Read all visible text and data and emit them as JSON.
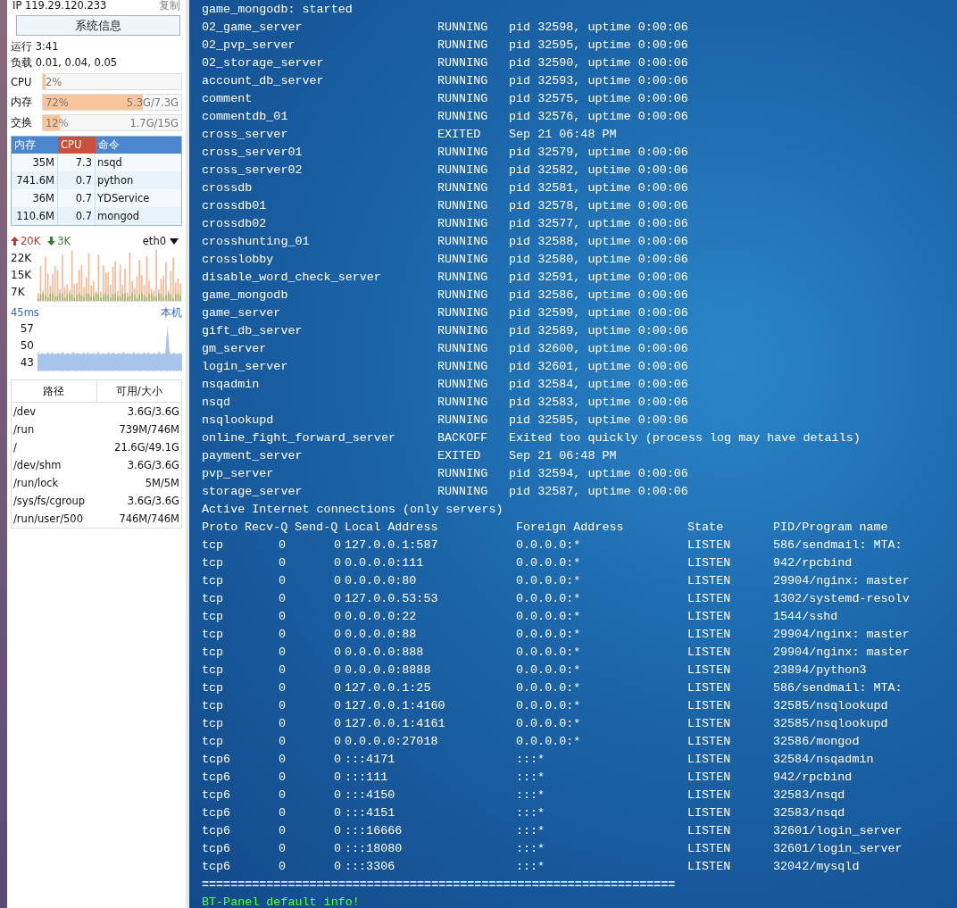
{
  "sidebar": {
    "ip": "IP 119.29.120.233",
    "copy_link": "复制",
    "sysinfo_button": "系统信息",
    "uptime": "运行 3:41",
    "load": "负载 0.01, 0.04, 0.05",
    "meters": [
      {
        "label": "CPU",
        "percent": "2%",
        "level": 0.02
      },
      {
        "label": "内存",
        "percent": "72%",
        "amount": "5.3G/7.3G",
        "level": 0.72
      },
      {
        "label": "交换",
        "percent": "12%",
        "amount": "1.7G/15G",
        "level": 0.12
      }
    ],
    "process_table": {
      "columns": [
        {
          "label": "内存",
          "selected": false
        },
        {
          "label": "CPU",
          "selected": true
        },
        {
          "label": "命令",
          "selected": false
        }
      ],
      "rows": [
        [
          "35M",
          "7.3",
          "nsqd"
        ],
        [
          "741.6M",
          "0.7",
          "python"
        ],
        [
          "36M",
          "0.7",
          "YDService"
        ],
        [
          "110.6M",
          "0.7",
          "mongod"
        ]
      ]
    },
    "network": {
      "up": "20K",
      "down": "3K",
      "interface": "eth0",
      "ticks": [
        "22K",
        "15K",
        "7K"
      ]
    },
    "ping": {
      "latency": "45ms",
      "host": "本机",
      "ticks": [
        "57",
        "50",
        "43"
      ]
    },
    "disk_table": {
      "columns": [
        "路径",
        "可用/大小"
      ],
      "rows": [
        [
          "/dev",
          "3.6G/3.6G"
        ],
        [
          "/run",
          "739M/746M"
        ],
        [
          "/",
          "21.6G/49.1G"
        ],
        [
          "/dev/shm",
          "3.6G/3.6G"
        ],
        [
          "/run/lock",
          "5M/5M"
        ],
        [
          "/sys/fs/cgroup",
          "3.6G/3.6G"
        ],
        [
          "/run/user/500",
          "746M/746M"
        ]
      ]
    }
  },
  "terminal": {
    "first_line": "game_mongodb: started",
    "services": [
      [
        "02_game_server",
        "RUNNING",
        "pid 32598, uptime 0:00:06"
      ],
      [
        "02_pvp_server",
        "RUNNING",
        "pid 32595, uptime 0:00:06"
      ],
      [
        "02_storage_server",
        "RUNNING",
        "pid 32590, uptime 0:00:06"
      ],
      [
        "account_db_server",
        "RUNNING",
        "pid 32593, uptime 0:00:06"
      ],
      [
        "comment",
        "RUNNING",
        "pid 32575, uptime 0:00:06"
      ],
      [
        "commentdb_01",
        "RUNNING",
        "pid 32576, uptime 0:00:06"
      ],
      [
        "cross_server",
        "EXITED",
        "Sep 21 06:48 PM"
      ],
      [
        "cross_server01",
        "RUNNING",
        "pid 32579, uptime 0:00:06"
      ],
      [
        "cross_server02",
        "RUNNING",
        "pid 32582, uptime 0:00:06"
      ],
      [
        "crossdb",
        "RUNNING",
        "pid 32581, uptime 0:00:06"
      ],
      [
        "crossdb01",
        "RUNNING",
        "pid 32578, uptime 0:00:06"
      ],
      [
        "crossdb02",
        "RUNNING",
        "pid 32577, uptime 0:00:06"
      ],
      [
        "crosshunting_01",
        "RUNNING",
        "pid 32588, uptime 0:00:06"
      ],
      [
        "crosslobby",
        "RUNNING",
        "pid 32580, uptime 0:00:06"
      ],
      [
        "disable_word_check_server",
        "RUNNING",
        "pid 32591, uptime 0:00:06"
      ],
      [
        "game_mongodb",
        "RUNNING",
        "pid 32586, uptime 0:00:06"
      ],
      [
        "game_server",
        "RUNNING",
        "pid 32599, uptime 0:00:06"
      ],
      [
        "gift_db_server",
        "RUNNING",
        "pid 32589, uptime 0:00:06"
      ],
      [
        "gm_server",
        "RUNNING",
        "pid 32600, uptime 0:00:06"
      ],
      [
        "login_server",
        "RUNNING",
        "pid 32601, uptime 0:00:06"
      ],
      [
        "nsqadmin",
        "RUNNING",
        "pid 32584, uptime 0:00:06"
      ],
      [
        "nsqd",
        "RUNNING",
        "pid 32583, uptime 0:00:06"
      ],
      [
        "nsqlookupd",
        "RUNNING",
        "pid 32585, uptime 0:00:06"
      ],
      [
        "online_fight_forward_server",
        "BACKOFF",
        "Exited too quickly (process log may have details)"
      ],
      [
        "payment_server",
        "EXITED",
        "Sep 21 06:48 PM"
      ],
      [
        "pvp_server",
        "RUNNING",
        "pid 32594, uptime 0:00:06"
      ],
      [
        "storage_server",
        "RUNNING",
        "pid 32587, uptime 0:00:06"
      ]
    ],
    "netstat_title": "Active Internet connections (only servers)",
    "netstat_columns": [
      "Proto",
      "Recv-Q",
      "Send-Q",
      "Local Address",
      "Foreign Address",
      "State",
      "PID/Program name"
    ],
    "netstat_rows": [
      [
        "tcp",
        "0",
        "0",
        "127.0.0.1:587",
        "0.0.0.0:*",
        "LISTEN",
        "586/sendmail: MTA:"
      ],
      [
        "tcp",
        "0",
        "0",
        "0.0.0.0:111",
        "0.0.0.0:*",
        "LISTEN",
        "942/rpcbind"
      ],
      [
        "tcp",
        "0",
        "0",
        "0.0.0.0:80",
        "0.0.0.0:*",
        "LISTEN",
        "29904/nginx: master"
      ],
      [
        "tcp",
        "0",
        "0",
        "127.0.0.53:53",
        "0.0.0.0:*",
        "LISTEN",
        "1302/systemd-resolv"
      ],
      [
        "tcp",
        "0",
        "0",
        "0.0.0.0:22",
        "0.0.0.0:*",
        "LISTEN",
        "1544/sshd"
      ],
      [
        "tcp",
        "0",
        "0",
        "0.0.0.0:88",
        "0.0.0.0:*",
        "LISTEN",
        "29904/nginx: master"
      ],
      [
        "tcp",
        "0",
        "0",
        "0.0.0.0:888",
        "0.0.0.0:*",
        "LISTEN",
        "29904/nginx: master"
      ],
      [
        "tcp",
        "0",
        "0",
        "0.0.0.0:8888",
        "0.0.0.0:*",
        "LISTEN",
        "23894/python3"
      ],
      [
        "tcp",
        "0",
        "0",
        "127.0.0.1:25",
        "0.0.0.0:*",
        "LISTEN",
        "586/sendmail: MTA:"
      ],
      [
        "tcp",
        "0",
        "0",
        "127.0.0.1:4160",
        "0.0.0.0:*",
        "LISTEN",
        "32585/nsqlookupd"
      ],
      [
        "tcp",
        "0",
        "0",
        "127.0.0.1:4161",
        "0.0.0.0:*",
        "LISTEN",
        "32585/nsqlookupd"
      ],
      [
        "tcp",
        "0",
        "0",
        "0.0.0.0:27018",
        "0.0.0.0:*",
        "LISTEN",
        "32586/mongod"
      ],
      [
        "tcp6",
        "0",
        "0",
        ":::4171",
        ":::*",
        "LISTEN",
        "32584/nsqadmin"
      ],
      [
        "tcp6",
        "0",
        "0",
        ":::111",
        ":::*",
        "LISTEN",
        "942/rpcbind"
      ],
      [
        "tcp6",
        "0",
        "0",
        ":::4150",
        ":::*",
        "LISTEN",
        "32583/nsqd"
      ],
      [
        "tcp6",
        "0",
        "0",
        ":::4151",
        ":::*",
        "LISTEN",
        "32583/nsqd"
      ],
      [
        "tcp6",
        "0",
        "0",
        ":::16666",
        ":::*",
        "LISTEN",
        "32601/login_server"
      ],
      [
        "tcp6",
        "0",
        "0",
        ":::18080",
        ":::*",
        "LISTEN",
        "32601/login_server"
      ],
      [
        "tcp6",
        "0",
        "0",
        ":::3306",
        ":::*",
        "LISTEN",
        "32042/mysqld"
      ]
    ],
    "separator": "==================================================================",
    "footer": "BT-Panel default info!"
  }
}
